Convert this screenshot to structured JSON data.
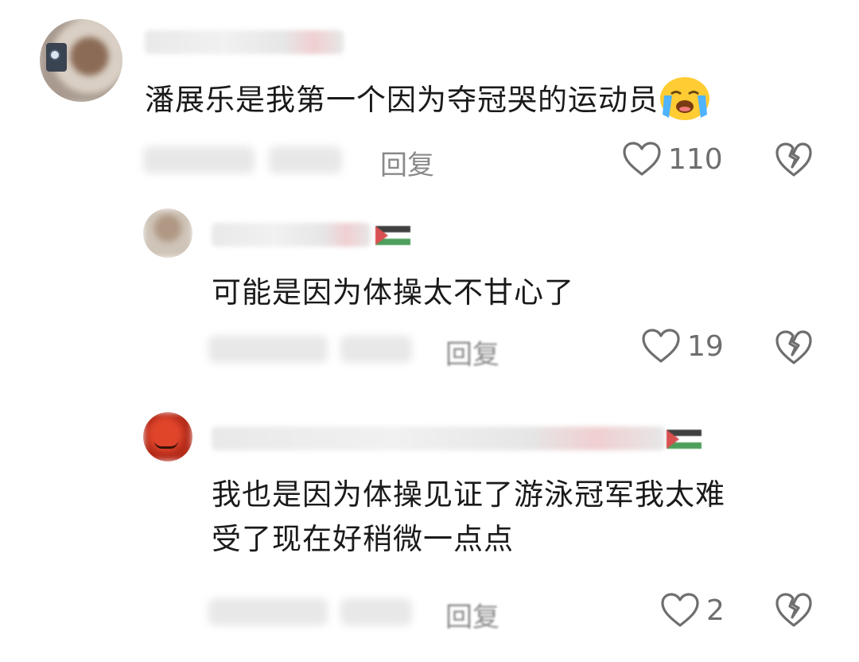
{
  "comments": [
    {
      "text": "潘展乐是我第一个因为夺冠哭的运动员",
      "emoji": "loudly-crying-face",
      "reply_label": "回复",
      "likes": "110"
    },
    {
      "text": "可能是因为体操太不甘心了",
      "reply_label": "回复",
      "likes": "19"
    },
    {
      "text_lines": [
        "我也是因为体操见证了游泳冠军我太难",
        "受了现在好稍微一点点"
      ],
      "reply_label": "回复",
      "likes": "2"
    }
  ],
  "icons": {
    "like": "heart-outline-icon",
    "dislike": "broken-heart-icon"
  },
  "colors": {
    "text": "#1a1a1a",
    "muted": "#8a8a8a",
    "icon": "#6e6e6e"
  }
}
